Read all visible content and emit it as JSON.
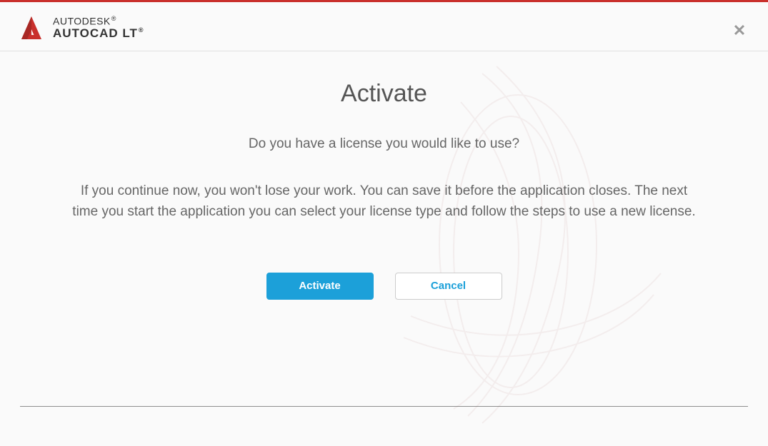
{
  "brand": {
    "company": "AUTODESK",
    "product": "AUTOCAD LT",
    "registered": "®"
  },
  "dialog": {
    "title": "Activate",
    "question": "Do you have a license you would like to use?",
    "description": "If you continue now, you won't lose your work. You can save it before the application closes. The next time you start the application you can select your license type and follow the steps to use a new license.",
    "activate_label": "Activate",
    "cancel_label": "Cancel"
  },
  "colors": {
    "accent_red": "#c9302c",
    "accent_blue": "#1ca0d9"
  }
}
